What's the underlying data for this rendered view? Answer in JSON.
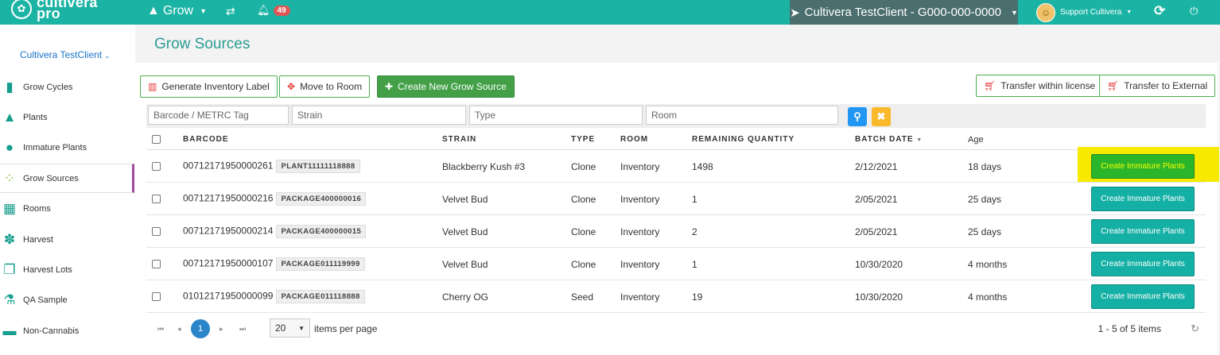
{
  "app": {
    "logo_line1": "cultivera",
    "logo_line2": "pro",
    "nav_grow": "Grow",
    "notifications_count": "49",
    "client_selector": "Cultivera TestClient - G000-000-0000",
    "user_name": "Support Cultivera"
  },
  "sidebar": {
    "client": "Cultivera TestClient",
    "items": [
      {
        "label": "Grow Cycles",
        "icon": "bar-chart-icon"
      },
      {
        "label": "Plants",
        "icon": "tree-icon"
      },
      {
        "label": "Immature Plants",
        "icon": "sapling-icon"
      },
      {
        "label": "Grow Sources",
        "icon": "seeds-icon"
      },
      {
        "label": "Rooms",
        "icon": "grid-icon"
      },
      {
        "label": "Harvest",
        "icon": "harvest-icon"
      },
      {
        "label": "Harvest Lots",
        "icon": "stack-icon"
      },
      {
        "label": "QA Sample",
        "icon": "flask-icon"
      },
      {
        "label": "Non-Cannabis",
        "icon": "box-icon"
      }
    ]
  },
  "page": {
    "title": "Grow Sources",
    "buttons": {
      "generate_label": "Generate Inventory Label",
      "move_room": "Move to Room",
      "create_new": "Create New Grow Source",
      "transfer_within": "Transfer within license",
      "transfer_external": "Transfer to External"
    },
    "filters": {
      "barcode_placeholder": "Barcode / METRC Tag",
      "strain_placeholder": "Strain",
      "type_placeholder": "Type",
      "room_placeholder": "Room"
    }
  },
  "table": {
    "headers": {
      "barcode": "BARCODE",
      "strain": "STRAIN",
      "type": "TYPE",
      "room": "ROOM",
      "remaining": "REMAINING QUANTITY",
      "batch_date": "BATCH DATE",
      "age": "Age"
    },
    "action_label": "Create Immature Plants",
    "rows": [
      {
        "barcode": "00712171950000261",
        "tag": "PLANT11111118888",
        "strain": "Blackberry Kush #3",
        "type": "Clone",
        "room": "Inventory",
        "qty": "1498",
        "date": "2/12/2021",
        "age": "18 days"
      },
      {
        "barcode": "00712171950000216",
        "tag": "PACKAGE400000016",
        "strain": "Velvet Bud",
        "type": "Clone",
        "room": "Inventory",
        "qty": "1",
        "date": "2/05/2021",
        "age": "25 days"
      },
      {
        "barcode": "00712171950000214",
        "tag": "PACKAGE400000015",
        "strain": "Velvet Bud",
        "type": "Clone",
        "room": "Inventory",
        "qty": "2",
        "date": "2/05/2021",
        "age": "25 days"
      },
      {
        "barcode": "00712171950000107",
        "tag": "PACKAGE011119999",
        "strain": "Velvet Bud",
        "type": "Clone",
        "room": "Inventory",
        "qty": "1",
        "date": "10/30/2020",
        "age": "4 months"
      },
      {
        "barcode": "01012171950000099",
        "tag": "PACKAGE011118888",
        "strain": "Cherry OG",
        "type": "Seed",
        "room": "Inventory",
        "qty": "19",
        "date": "10/30/2020",
        "age": "4 months"
      }
    ]
  },
  "pager": {
    "current_page": "1",
    "page_size": "20",
    "items_label": "items per page",
    "info": "1 - 5 of 5 items"
  }
}
